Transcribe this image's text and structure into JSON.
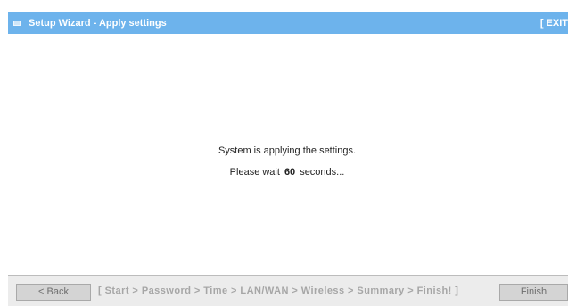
{
  "window": {
    "title": "Setup Wizard - Apply settings",
    "exit_label": "[ EXIT"
  },
  "content": {
    "line1": "System is applying the settings.",
    "line2_prefix": "Please wait",
    "countdown_seconds": "60",
    "line2_suffix": "seconds..."
  },
  "footer": {
    "back_label": "< Back",
    "steps": "[ Start > Password > Time > LAN/WAN > Wireless > Summary > Finish! ]",
    "finish_label": "Finish"
  },
  "colors": {
    "titlebar": "#6db3ec",
    "footer_background": "#ececec",
    "disabled_text": "#a6a6a6"
  },
  "icons": [
    "window-icon"
  ]
}
